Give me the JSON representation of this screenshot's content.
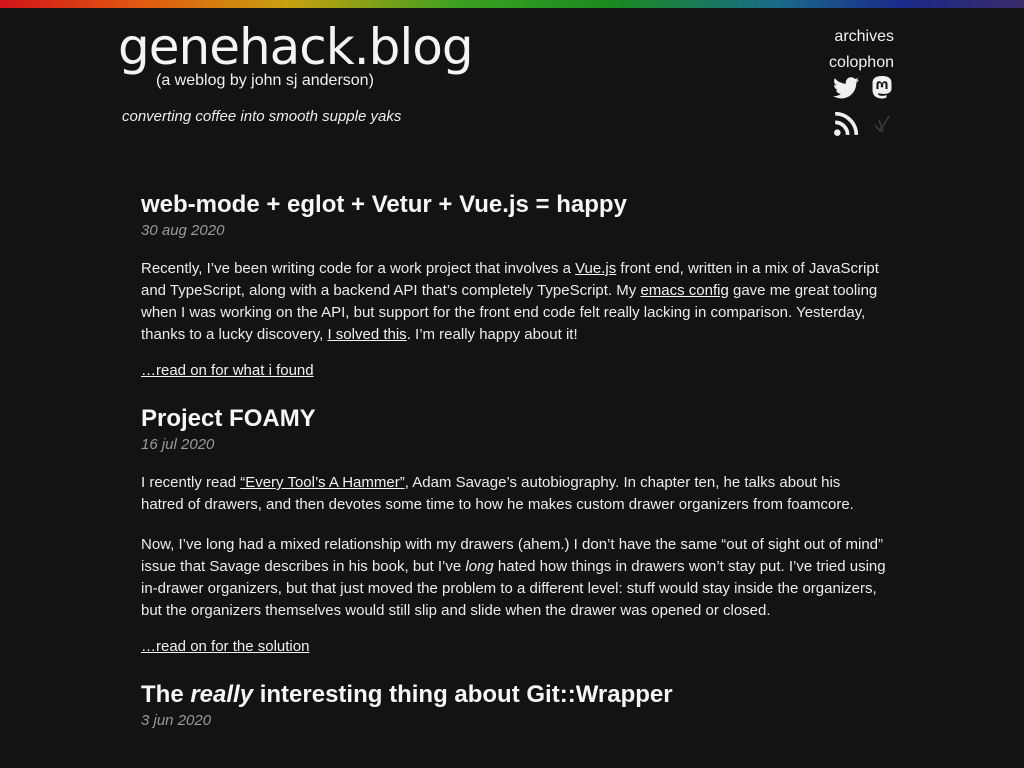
{
  "colors": {
    "background": "#131313",
    "text": "#ececec",
    "date": "#9a9a9a"
  },
  "header": {
    "logo": "genehack.blog",
    "byline": "(a weblog by john sj anderson)",
    "tagline": "converting coffee into smooth supple yaks"
  },
  "nav": {
    "archives": "archives",
    "colophon": "colophon",
    "icons": [
      "twitter-icon",
      "mastodon-icon",
      "rss-icon",
      "indieweb-icon"
    ]
  },
  "posts": [
    {
      "title": "web-mode + eglot + Vetur + Vue.js = happy",
      "date": "30 aug 2020",
      "p1": {
        "t1": "Recently, I’ve been writing code for a work project that involves a ",
        "l1": "Vue.js",
        "t2": " front end, written in a mix of JavaScript and TypeScript, along with a backend API that’s completely TypeScript. My ",
        "l2": "emacs config",
        "t3": " gave me great tooling when I was working on the API, but support for the front end code felt really lacking in comparison. Yesterday, thanks to a lucky discovery, ",
        "l3": "I solved this",
        "t4": ". I’m really happy about it!"
      },
      "more": "…read on for what i found"
    },
    {
      "title": "Project FOAMY",
      "date": "16 jul 2020",
      "p1": {
        "t1": "I recently read ",
        "l1": "“Every Tool’s A Hammer”",
        "t2": ", Adam Savage’s autobiography. In chapter ten, he talks about his hatred of drawers, and then devotes some time to how he makes custom drawer organizers from foamcore."
      },
      "p2": {
        "t1": "Now, I’ve long had a mixed relationship with my drawers (ahem.) I don’t have the same “out of sight out of mind” issue that Savage describes in his book, but I’ve ",
        "em": "long",
        "t2": " hated how things in drawers won’t stay put. I’ve tried using in-drawer organizers, but that just moved the problem to a different level: stuff would stay inside the organizers, but the organizers themselves would still slip and slide when the drawer was opened or closed."
      },
      "more": "…read on for the solution"
    },
    {
      "title_pre": "The ",
      "title_em": "really",
      "title_post": " interesting thing about Git::Wrapper",
      "date": "3 jun 2020"
    }
  ]
}
